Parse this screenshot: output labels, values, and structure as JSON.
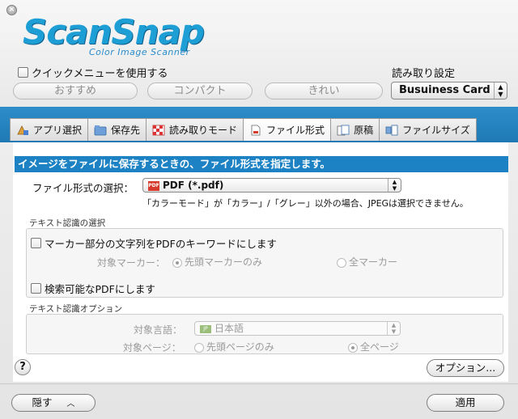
{
  "window": {
    "close_glyph": "×",
    "logo_main": "ScanSnap",
    "logo_sub": "Color Image Scanner"
  },
  "quick_menu": {
    "label": "クイックメニューを使用する",
    "checked": false
  },
  "profile_buttons": [
    "おすすめ",
    "コンパクト",
    "きれい"
  ],
  "read_settings": {
    "label": "読み取り設定",
    "selected": "Busuiness Card"
  },
  "tabs": [
    {
      "label": "アプリ選択",
      "icon": "app-icon",
      "active": false
    },
    {
      "label": "保存先",
      "icon": "folder-icon",
      "active": false
    },
    {
      "label": "読み取りモード",
      "icon": "checkerboard-icon",
      "active": false
    },
    {
      "label": "ファイル形式",
      "icon": "document-icon",
      "active": true
    },
    {
      "label": "原稿",
      "icon": "pages-icon",
      "active": false
    },
    {
      "label": "ファイルサイズ",
      "icon": "size-icon",
      "active": false
    }
  ],
  "panel": {
    "header": "イメージをファイルに保存するときの、ファイル形式を指定します。",
    "format_label": "ファイル形式の選択：",
    "format_value": "PDF (*.pdf)",
    "pdf_badge": "PDF",
    "format_note": "「カラーモード」が「カラー」/「グレー」以外の場合、JPEGは選択できません。",
    "text_rec_section": "テキスト認識の選択",
    "marker_checkbox": "マーカー部分の文字列をPDFのキーワードにします",
    "target_marker_label": "対象マーカー：",
    "marker_first_only": "先頭マーカーのみ",
    "marker_all": "全マーカー",
    "searchable_checkbox": "検索可能なPDFにします",
    "text_rec_options_section": "テキスト認識オプション",
    "language_label": "対象言語：",
    "language_value": "日本語",
    "language_badge": "JP",
    "pages_label": "対象ページ：",
    "pages_first_only": "先頭ページのみ",
    "pages_all": "全ページ",
    "options_button": "オプション..."
  },
  "footer": {
    "hide_button": "隠す",
    "apply_button": "適用",
    "help_glyph": "?"
  },
  "colors": {
    "accent_blue": "#1c82c4",
    "logo_blue": "#1d9fd6"
  }
}
